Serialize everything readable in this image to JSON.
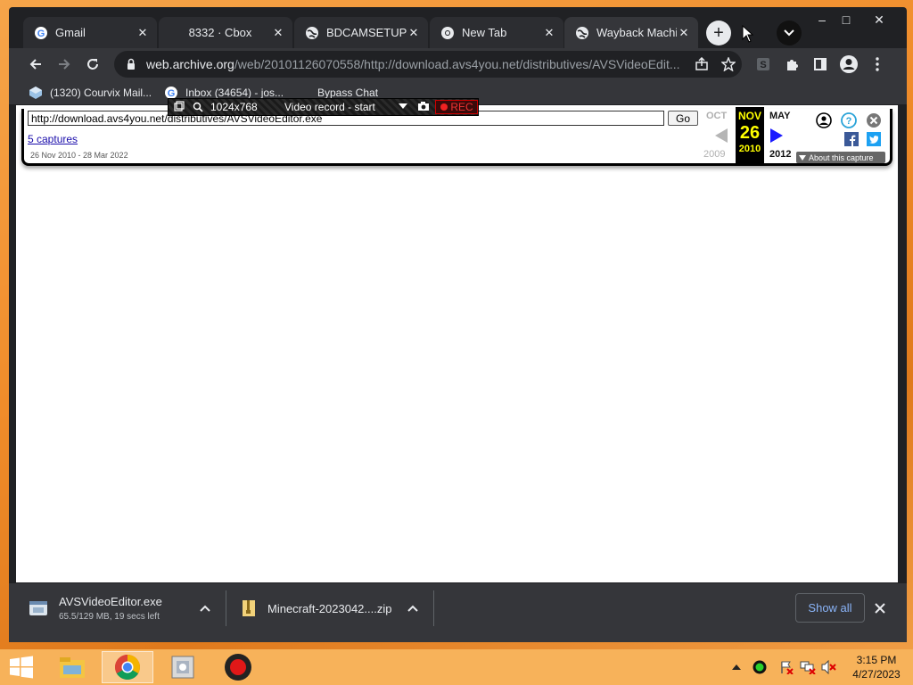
{
  "tabs": [
    {
      "title": "Gmail",
      "icon": "google-icon",
      "active": false
    },
    {
      "title": "8332 · Cbox",
      "icon": "none",
      "active": false
    },
    {
      "title": "BDCAMSETUP_E",
      "icon": "globe-icon",
      "active": false
    },
    {
      "title": "New Tab",
      "icon": "chrome-icon",
      "active": false
    },
    {
      "title": "Wayback Machin",
      "icon": "globe-icon",
      "active": true
    }
  ],
  "window_controls": {
    "minimize": "–",
    "maximize": "□",
    "close": "✕"
  },
  "address_bar": {
    "host": "web.archive.org",
    "path": "/web/20101126070558/http://download.avs4you.net/distributives/AVSVideoEdit..."
  },
  "bookmarks": [
    {
      "label": "(1320) Courvix Mail...",
      "icon": "courvix-icon"
    },
    {
      "label": "Inbox (34654) - jos...",
      "icon": "google-icon"
    },
    {
      "label": "Bypass Chat",
      "icon": "none"
    }
  ],
  "recorder": {
    "resolution": "1024x768",
    "mode": "Video record - start",
    "rec_label": "REC"
  },
  "wayback": {
    "url_value": "http://download.avs4you.net/distributives/AVSVideoEditor.exe",
    "go_label": "Go",
    "captures_link": "5 captures",
    "date_range": "26 Nov 2010 - 28 Mar 2022",
    "prev_month": "OCT",
    "prev_year": "2009",
    "cur_month": "NOV",
    "cur_day": "26",
    "cur_year": "2010",
    "next_month": "MAY",
    "next_year": "2012",
    "about_label": "About this capture",
    "colors": {
      "highlight": "#ffff00",
      "arrow_next": "#1a1aff",
      "arrow_prev": "#b5b5b5"
    }
  },
  "downloads": {
    "items": [
      {
        "name": "AVSVideoEditor.exe",
        "status": "65.5/129 MB, 19 secs left",
        "progress": 0.508
      },
      {
        "name": "Minecraft-2023042....zip",
        "status": ""
      }
    ],
    "show_all_label": "Show all"
  },
  "taskbar": {
    "time": "3:15 PM",
    "date": "4/27/2023"
  }
}
